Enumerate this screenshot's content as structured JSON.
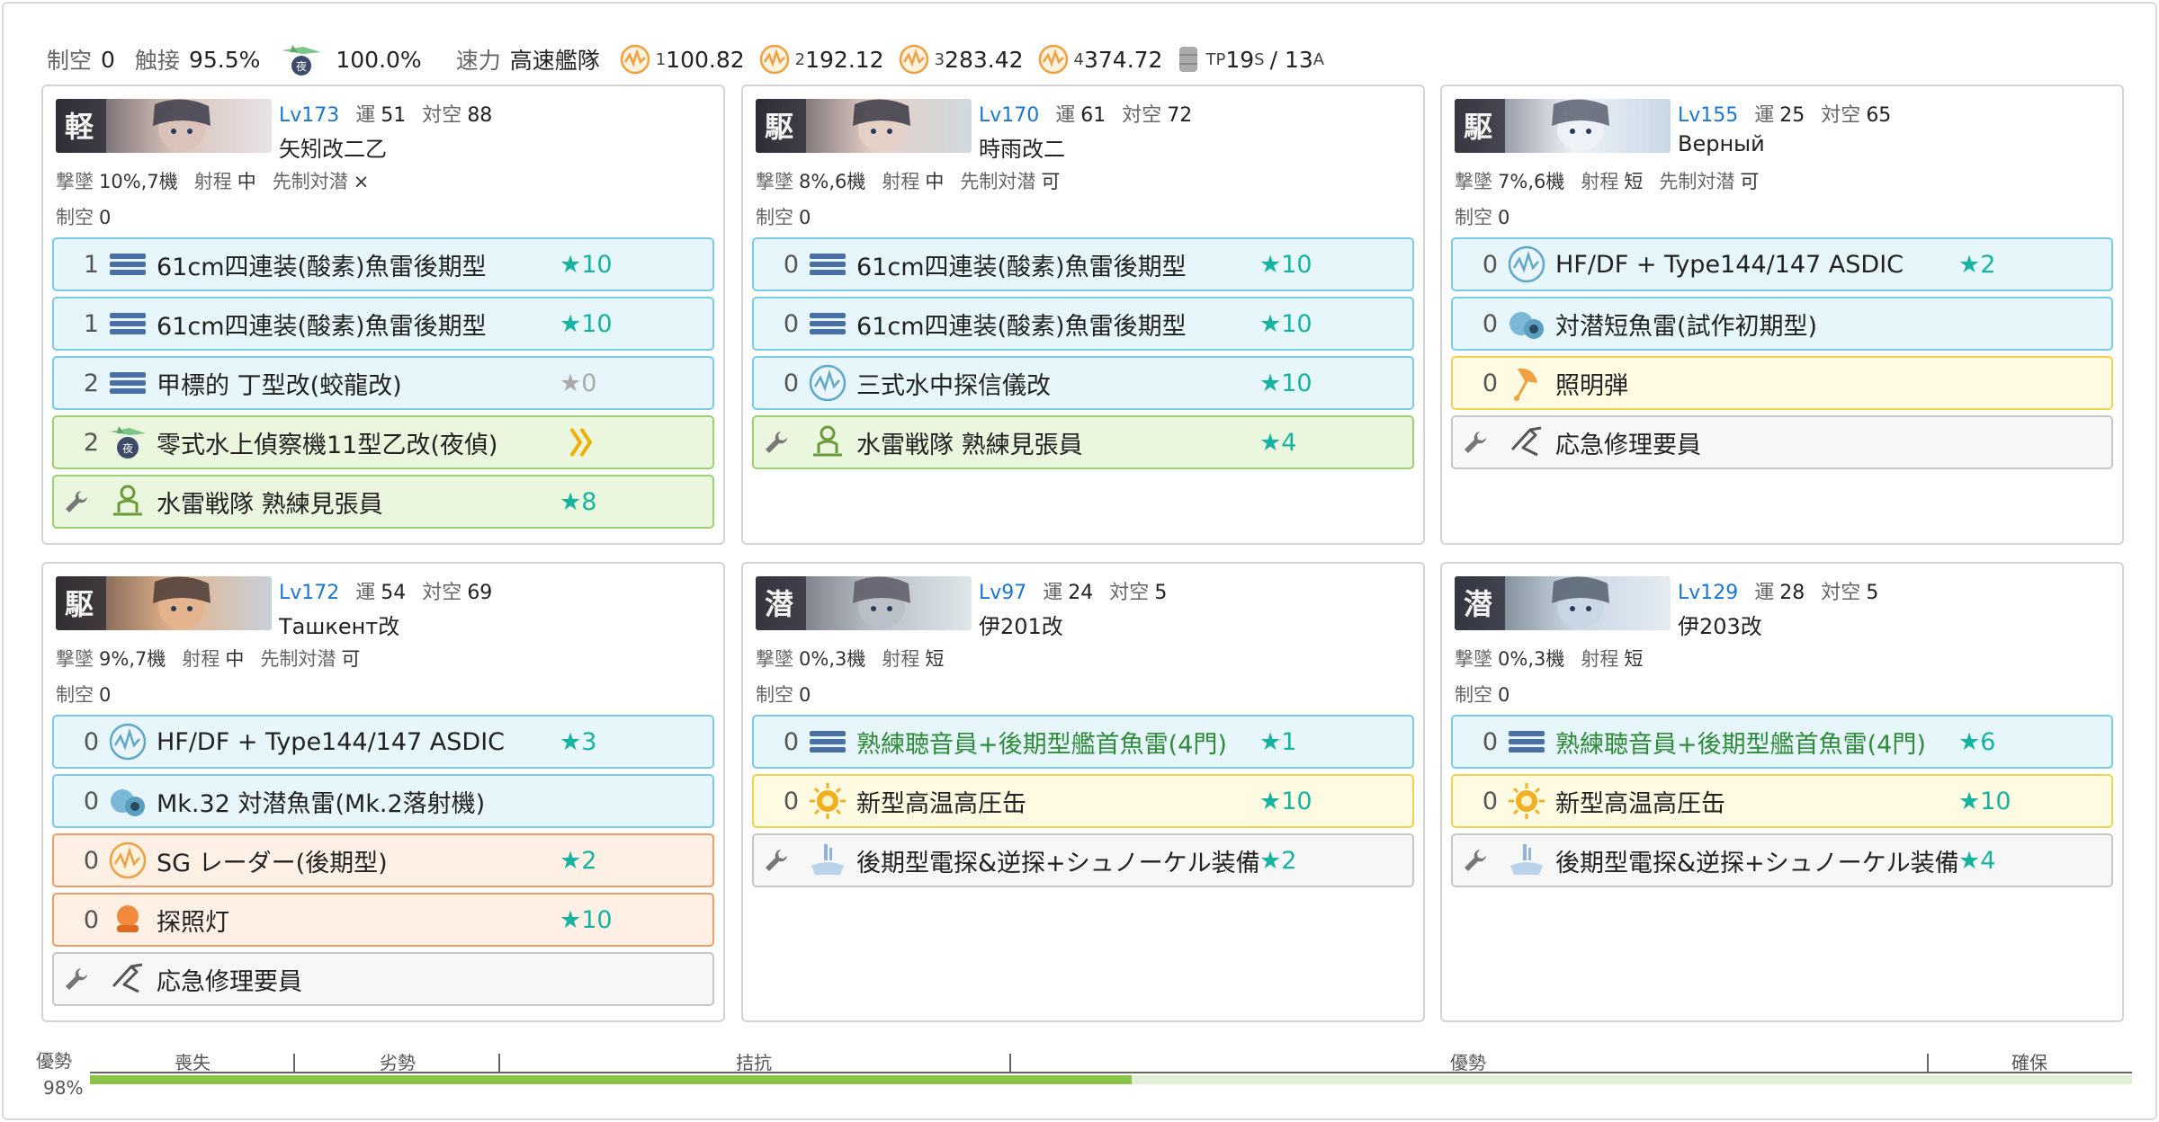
{
  "summary": {
    "air_label": "制空",
    "air_value": "0",
    "contact_label": "触接",
    "contact_value": "95.5%",
    "night_recon_value": "100.0%",
    "speed_label": "速力",
    "speed_value": "高速艦隊",
    "los": [
      {
        "idx": "1",
        "value": "100.82"
      },
      {
        "idx": "2",
        "value": "192.12"
      },
      {
        "idx": "3",
        "value": "283.42"
      },
      {
        "idx": "4",
        "value": "374.72"
      }
    ],
    "tp_label": "TP",
    "tp_s": "19",
    "tp_s_sub": "S",
    "tp_sep": "/ 13",
    "tp_a_sub": "A"
  },
  "labels": {
    "luck": "運",
    "aa": "対空",
    "shootdown": "撃墜",
    "range": "射程",
    "oasw": "先制対潜",
    "airpower": "制空"
  },
  "ships": [
    {
      "type_badge": "軽",
      "level": "Lv173",
      "luck": "51",
      "aa": "88",
      "name": "矢矧改二乙",
      "shootdown": "10%,7機",
      "range": "中",
      "oasw": "×",
      "airpower": "0",
      "slots": [
        {
          "count": "1",
          "icon": "torpedo-icon",
          "name": "61cm四連装(酸素)魚雷後期型",
          "star": "★10",
          "color": "blue"
        },
        {
          "count": "1",
          "icon": "torpedo-icon",
          "name": "61cm四連装(酸素)魚雷後期型",
          "star": "★10",
          "color": "blue"
        },
        {
          "count": "2",
          "icon": "torpedo-icon",
          "name": "甲標的 丁型改(蛟龍改)",
          "star": "★0",
          "color": "blue",
          "dim": true
        },
        {
          "count": "2",
          "icon": "night-seaplane-icon",
          "name": "零式水上偵察機11型乙改(夜偵)",
          "star": "",
          "color": "green",
          "prof": true
        },
        {
          "count": "",
          "icon": "lookout-icon",
          "name": "水雷戦隊 熟練見張員",
          "star": "★8",
          "color": "green",
          "ex": true
        }
      ]
    },
    {
      "type_badge": "駆",
      "level": "Lv170",
      "luck": "61",
      "aa": "72",
      "name": "時雨改二",
      "shootdown": "8%,6機",
      "range": "中",
      "oasw": "可",
      "airpower": "0",
      "slots": [
        {
          "count": "0",
          "icon": "torpedo-icon",
          "name": "61cm四連装(酸素)魚雷後期型",
          "star": "★10",
          "color": "blue"
        },
        {
          "count": "0",
          "icon": "torpedo-icon",
          "name": "61cm四連装(酸素)魚雷後期型",
          "star": "★10",
          "color": "blue"
        },
        {
          "count": "0",
          "icon": "sonar-icon",
          "name": "三式水中探信儀改",
          "star": "★10",
          "color": "blue"
        },
        {
          "count": "",
          "icon": "lookout-icon",
          "name": "水雷戦隊 熟練見張員",
          "star": "★4",
          "color": "green",
          "ex": true
        }
      ]
    },
    {
      "type_badge": "駆",
      "level": "Lv155",
      "luck": "25",
      "aa": "65",
      "name": "Верный",
      "shootdown": "7%,6機",
      "range": "短",
      "oasw": "可",
      "airpower": "0",
      "slots": [
        {
          "count": "0",
          "icon": "sonar-icon",
          "name": "HF/DF + Type144/147 ASDIC",
          "star": "★2",
          "color": "blue"
        },
        {
          "count": "0",
          "icon": "depth-charge-icon",
          "name": "対潜短魚雷(試作初期型)",
          "star": "",
          "color": "blue"
        },
        {
          "count": "0",
          "icon": "star-shell-icon",
          "name": "照明弾",
          "star": "",
          "color": "yellow"
        },
        {
          "count": "",
          "icon": "repair-team-icon",
          "name": "応急修理要員",
          "star": "",
          "color": "gray",
          "ex": true
        }
      ]
    },
    {
      "type_badge": "駆",
      "level": "Lv172",
      "luck": "54",
      "aa": "69",
      "name": "Ташкент改",
      "shootdown": "9%,7機",
      "range": "中",
      "oasw": "可",
      "airpower": "0",
      "slots": [
        {
          "count": "0",
          "icon": "sonar-icon",
          "name": "HF/DF + Type144/147 ASDIC",
          "star": "★3",
          "color": "blue"
        },
        {
          "count": "0",
          "icon": "depth-charge-icon",
          "name": "Mk.32 対潜魚雷(Mk.2落射機)",
          "star": "",
          "color": "blue"
        },
        {
          "count": "0",
          "icon": "radar-icon",
          "name": "SG レーダー(後期型)",
          "star": "★2",
          "color": "orange"
        },
        {
          "count": "0",
          "icon": "searchlight-icon",
          "name": "探照灯",
          "star": "★10",
          "color": "orange"
        },
        {
          "count": "",
          "icon": "repair-team-icon",
          "name": "応急修理要員",
          "star": "",
          "color": "gray",
          "ex": true
        }
      ]
    },
    {
      "type_badge": "潜",
      "level": "Lv97",
      "luck": "24",
      "aa": "5",
      "name": "伊201改",
      "shootdown": "0%,3機",
      "range": "短",
      "oasw": "",
      "airpower": "0",
      "slots": [
        {
          "count": "0",
          "icon": "torpedo-icon",
          "name": "熟練聴音員+後期型艦首魚雷(4門)",
          "star": "★1",
          "color": "blue",
          "special": true
        },
        {
          "count": "0",
          "icon": "boiler-icon",
          "name": "新型高温高圧缶",
          "star": "★10",
          "color": "yellow"
        },
        {
          "count": "",
          "icon": "sub-equipment-icon",
          "name": "後期型電探&逆探+シュノーケル装備",
          "star": "★2",
          "color": "gray",
          "ex": true
        }
      ]
    },
    {
      "type_badge": "潜",
      "level": "Lv129",
      "luck": "28",
      "aa": "5",
      "name": "伊203改",
      "shootdown": "0%,3機",
      "range": "短",
      "oasw": "",
      "airpower": "0",
      "slots": [
        {
          "count": "0",
          "icon": "torpedo-icon",
          "name": "熟練聴音員+後期型艦首魚雷(4門)",
          "star": "★6",
          "color": "blue",
          "special": true
        },
        {
          "count": "0",
          "icon": "boiler-icon",
          "name": "新型高温高圧缶",
          "star": "★10",
          "color": "yellow"
        },
        {
          "count": "",
          "icon": "sub-equipment-icon",
          "name": "後期型電探&逆探+シュノーケル装備",
          "star": "★4",
          "color": "gray",
          "ex": true
        }
      ]
    }
  ],
  "air_state": {
    "current": "優勢",
    "percent": "98%",
    "fill_fraction": 0.51,
    "segments": [
      "喪失",
      "劣勢",
      "拮抗",
      "優勢",
      "確保"
    ]
  }
}
